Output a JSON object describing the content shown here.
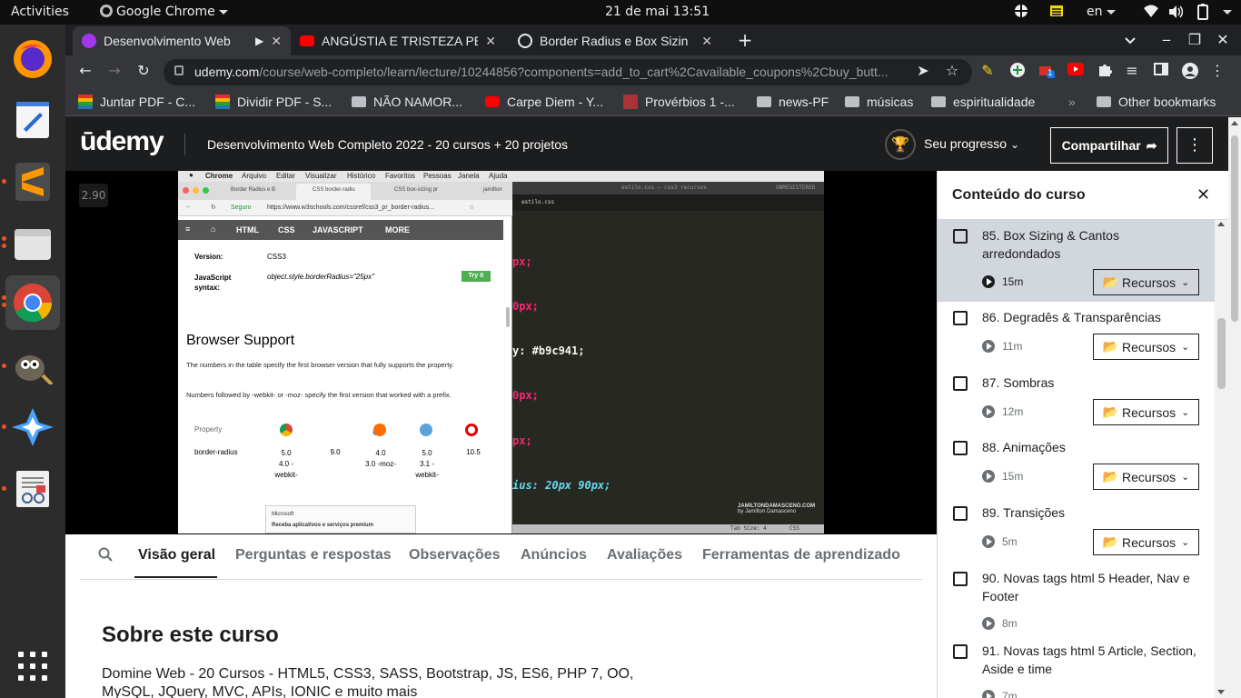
{
  "topbar": {
    "activities": "Activities",
    "app": "Google Chrome",
    "datetime": "21 de mai  13:51",
    "lang": "en"
  },
  "chrome": {
    "tabs": [
      {
        "title": "Desenvolvimento Web",
        "favicon_color": "#a435f0"
      },
      {
        "title": "ANGÚSTIA E TRISTEZA PE",
        "favicon_color": "#ff0000"
      },
      {
        "title": "Border Radius e Box Sizin",
        "favicon_color": "#e8eaed"
      }
    ],
    "url_host": "udemy.com",
    "url_path": "/course/web-completo/learn/lecture/10244856?components=add_to_cart%2Cavailable_coupons%2Cbuy_butt...",
    "extension_badge": "1",
    "bookmarks": [
      {
        "label": "Juntar PDF - C..."
      },
      {
        "label": "Dividir PDF - S..."
      },
      {
        "label": "NÃO NAMOR..."
      },
      {
        "label": "Carpe Diem - Y..."
      },
      {
        "label": "Provérbios 1 -..."
      },
      {
        "label": "news-PF"
      },
      {
        "label": "músicas"
      },
      {
        "label": "espiritualidade"
      },
      {
        "label": "Other bookmarks"
      }
    ]
  },
  "udemy": {
    "logo": "ūdemy",
    "course_title": "Desenvolvimento Web Completo 2022 - 20 cursos + 20 projetos",
    "progress_label": "Seu progresso",
    "share_label": "Compartilhar",
    "video": {
      "speed_badge": "2.90",
      "mac_menu": [
        "Chrome",
        "Arquivo",
        "Editar",
        "Visualizar",
        "Histórico",
        "Favoritos",
        "Pessoas",
        "Janela",
        "Ajuda"
      ],
      "inner_tabs": [
        "Border Radius e B",
        "CSS border-radiu",
        "CSS box-sizing pr",
        "jamilton"
      ],
      "inner_url_secure": "Seguro",
      "inner_url": "https://www.w3schools.com/cssref/css3_pr_border-radius...",
      "w3_nav": [
        "HTML",
        "CSS",
        "JAVASCRIPT",
        "MORE"
      ],
      "version_label": "Version:",
      "version_value": "CSS3",
      "js_syntax_label": "JavaScript syntax:",
      "js_syntax_value": "object.style.borderRadius=\"25px\"",
      "try_it": "Try it",
      "browser_support_title": "Browser Support",
      "bs_text1": "The numbers in the table specify the first browser version that fully supports the property.",
      "bs_text2": "Numbers followed by -webkit- or -moz- specify the first version that worked with a prefix.",
      "bs_property_header": "Property",
      "bs_row_name": "border-radius",
      "bs_values": [
        "5.0\n4.0 -\nwebkit-",
        "9.0",
        "4.0\n3.0 -moz-",
        "5.0\n3.1 -\nwebkit-",
        "10.5"
      ],
      "ad_text": "Microsoft",
      "ad_sub": "Receba aplicativos e serviços premium",
      "editor_filename": "estilo.css",
      "editor_title": "estilo.css — css3 recursos",
      "editor_unregistered": "UNREGISTERED",
      "code_lines": [
        "px;",
        "0px;",
        "y: #b9c941;",
        "0px;",
        "px;",
        "ius: 20px 90px;"
      ],
      "watermark_1": "JAMILTONDAMASCENO.COM",
      "watermark_2": "by Jamilton Damasceno",
      "editor_status_1": "Tab Size: 4",
      "editor_status_2": "CSS"
    },
    "tabs": [
      "Visão geral",
      "Perguntas e respostas",
      "Observações",
      "Anúncios",
      "Avaliações",
      "Ferramentas de aprendizado"
    ],
    "about_title": "Sobre este curso",
    "about_text": "Domine Web - 20 Cursos - HTML5, CSS3, SASS, Bootstrap, JS, ES6, PHP 7, OO, MySQL, JQuery, MVC, APIs, IONIC e muito mais",
    "sidebar_title": "Conteúdo do curso",
    "resources_label": "Recursos",
    "lectures": [
      {
        "title": "85. Box Sizing & Cantos arredondados",
        "duration": "15m",
        "resources": true,
        "active": true
      },
      {
        "title": "86. Degradês & Transparências",
        "duration": "11m",
        "resources": true
      },
      {
        "title": "87. Sombras",
        "duration": "12m",
        "resources": true
      },
      {
        "title": "88. Animações",
        "duration": "15m",
        "resources": true
      },
      {
        "title": "89. Transições",
        "duration": "5m",
        "resources": true
      },
      {
        "title": "90. Novas tags html 5 Header, Nav e Footer",
        "duration": "8m",
        "resources": false
      },
      {
        "title": "91. Novas tags html 5 Article, Section, Aside e time",
        "duration": "7m",
        "resources": false
      }
    ]
  }
}
